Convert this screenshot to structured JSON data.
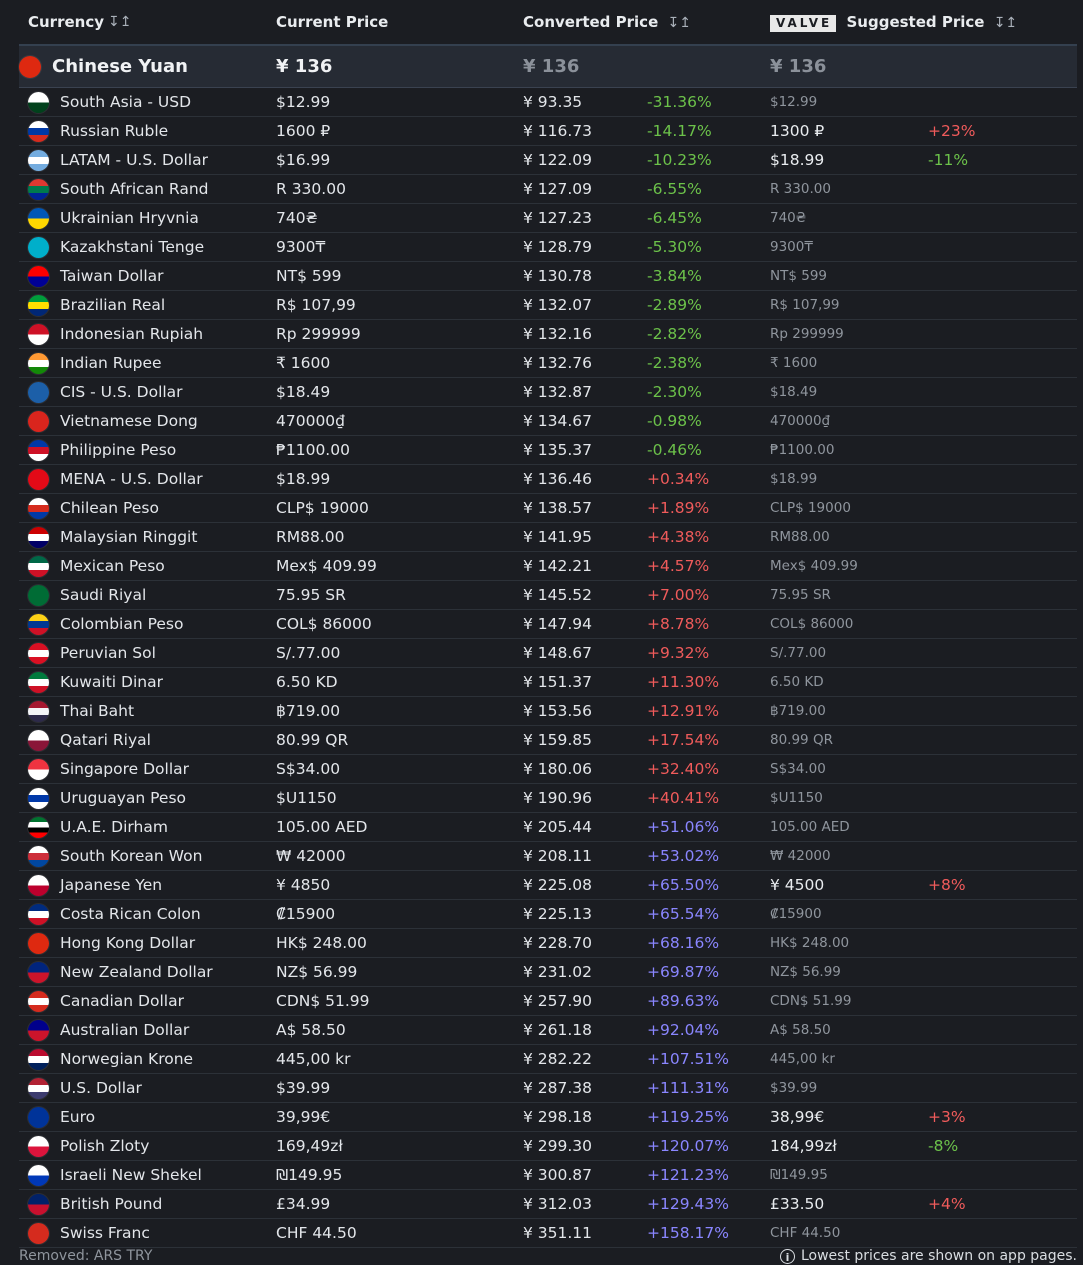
{
  "header": {
    "currency": "Currency",
    "current_price": "Current Price",
    "converted_price": "Converted Price",
    "valve_logo": "VALVE",
    "suggested_price": "Suggested Price",
    "sort_icon": "↧↥"
  },
  "base": {
    "name": "Chinese Yuan",
    "price": "¥ 136",
    "converted": "¥ 136",
    "suggested": "¥ 136",
    "flag_icon": "china-flag-icon",
    "flag_colors": [
      "#de2910",
      "#de2910"
    ]
  },
  "rows": [
    {
      "name": "South Asia - USD",
      "price": "$12.99",
      "converted": "¥ 93.35",
      "diff": "-31.36%",
      "diff_class": "green",
      "suggested": "$12.99",
      "sugg_hl": false,
      "sugg_diff": "",
      "sugg_diff_class": "",
      "flag_icon": "south-asia-flag-icon",
      "flag_colors": [
        "#ffffff",
        "#01411c"
      ]
    },
    {
      "name": "Russian Ruble",
      "price": "1600 ₽",
      "converted": "¥ 116.73",
      "diff": "-14.17%",
      "diff_class": "green",
      "suggested": "1300 ₽",
      "sugg_hl": true,
      "sugg_diff": "+23%",
      "sugg_diff_class": "red",
      "flag_icon": "russia-flag-icon",
      "flag_colors": [
        "#ffffff",
        "#0039a6",
        "#d52b1e"
      ]
    },
    {
      "name": "LATAM - U.S. Dollar",
      "price": "$16.99",
      "converted": "¥ 122.09",
      "diff": "-10.23%",
      "diff_class": "green",
      "suggested": "$18.99",
      "sugg_hl": true,
      "sugg_diff": "-11%",
      "sugg_diff_class": "green",
      "flag_icon": "latam-flag-icon",
      "flag_colors": [
        "#74acdf",
        "#ffffff",
        "#74acdf"
      ]
    },
    {
      "name": "South African Rand",
      "price": "R 330.00",
      "converted": "¥ 127.09",
      "diff": "-6.55%",
      "diff_class": "green",
      "suggested": "R 330.00",
      "sugg_hl": false,
      "sugg_diff": "",
      "sugg_diff_class": "",
      "flag_icon": "south-africa-flag-icon",
      "flag_colors": [
        "#de3831",
        "#007a4d",
        "#002395"
      ]
    },
    {
      "name": "Ukrainian Hryvnia",
      "price": "740₴",
      "converted": "¥ 127.23",
      "diff": "-6.45%",
      "diff_class": "green",
      "suggested": "740₴",
      "sugg_hl": false,
      "sugg_diff": "",
      "sugg_diff_class": "",
      "flag_icon": "ukraine-flag-icon",
      "flag_colors": [
        "#0057b7",
        "#ffd700"
      ]
    },
    {
      "name": "Kazakhstani Tenge",
      "price": "9300₸",
      "converted": "¥ 128.79",
      "diff": "-5.30%",
      "diff_class": "green",
      "suggested": "9300₸",
      "sugg_hl": false,
      "sugg_diff": "",
      "sugg_diff_class": "",
      "flag_icon": "kazakhstan-flag-icon",
      "flag_colors": [
        "#00afca",
        "#00afca"
      ]
    },
    {
      "name": "Taiwan Dollar",
      "price": "NT$ 599",
      "converted": "¥ 130.78",
      "diff": "-3.84%",
      "diff_class": "green",
      "suggested": "NT$ 599",
      "sugg_hl": false,
      "sugg_diff": "",
      "sugg_diff_class": "",
      "flag_icon": "taiwan-flag-icon",
      "flag_colors": [
        "#fe0000",
        "#000095"
      ]
    },
    {
      "name": "Brazilian Real",
      "price": "R$ 107,99",
      "converted": "¥ 132.07",
      "diff": "-2.89%",
      "diff_class": "green",
      "suggested": "R$ 107,99",
      "sugg_hl": false,
      "sugg_diff": "",
      "sugg_diff_class": "",
      "flag_icon": "brazil-flag-icon",
      "flag_colors": [
        "#009c3b",
        "#ffdf00",
        "#002776"
      ]
    },
    {
      "name": "Indonesian Rupiah",
      "price": "Rp 299999",
      "converted": "¥ 132.16",
      "diff": "-2.82%",
      "diff_class": "green",
      "suggested": "Rp 299999",
      "sugg_hl": false,
      "sugg_diff": "",
      "sugg_diff_class": "",
      "flag_icon": "indonesia-flag-icon",
      "flag_colors": [
        "#ce1126",
        "#ffffff"
      ]
    },
    {
      "name": "Indian Rupee",
      "price": "₹ 1600",
      "converted": "¥ 132.76",
      "diff": "-2.38%",
      "diff_class": "green",
      "suggested": "₹ 1600",
      "sugg_hl": false,
      "sugg_diff": "",
      "sugg_diff_class": "",
      "flag_icon": "india-flag-icon",
      "flag_colors": [
        "#ff9933",
        "#ffffff",
        "#138808"
      ]
    },
    {
      "name": "CIS - U.S. Dollar",
      "price": "$18.49",
      "converted": "¥ 132.87",
      "diff": "-2.30%",
      "diff_class": "green",
      "suggested": "$18.49",
      "sugg_hl": false,
      "sugg_diff": "",
      "sugg_diff_class": "",
      "flag_icon": "cis-flag-icon",
      "flag_colors": [
        "#1c5fa8",
        "#1c5fa8"
      ]
    },
    {
      "name": "Vietnamese Dong",
      "price": "470000₫",
      "converted": "¥ 134.67",
      "diff": "-0.98%",
      "diff_class": "green",
      "suggested": "470000₫",
      "sugg_hl": false,
      "sugg_diff": "",
      "sugg_diff_class": "",
      "flag_icon": "vietnam-flag-icon",
      "flag_colors": [
        "#da251d",
        "#da251d"
      ]
    },
    {
      "name": "Philippine Peso",
      "price": "₱1100.00",
      "converted": "¥ 135.37",
      "diff": "-0.46%",
      "diff_class": "green",
      "suggested": "₱1100.00",
      "sugg_hl": false,
      "sugg_diff": "",
      "sugg_diff_class": "",
      "flag_icon": "philippines-flag-icon",
      "flag_colors": [
        "#0038a8",
        "#ce1126",
        "#ffffff"
      ]
    },
    {
      "name": "MENA - U.S. Dollar",
      "price": "$18.99",
      "converted": "¥ 136.46",
      "diff": "+0.34%",
      "diff_class": "red",
      "suggested": "$18.99",
      "sugg_hl": false,
      "sugg_diff": "",
      "sugg_diff_class": "",
      "flag_icon": "mena-flag-icon",
      "flag_colors": [
        "#e30a17",
        "#e30a17"
      ]
    },
    {
      "name": "Chilean Peso",
      "price": "CLP$ 19000",
      "converted": "¥ 138.57",
      "diff": "+1.89%",
      "diff_class": "red",
      "suggested": "CLP$ 19000",
      "sugg_hl": false,
      "sugg_diff": "",
      "sugg_diff_class": "",
      "flag_icon": "chile-flag-icon",
      "flag_colors": [
        "#ffffff",
        "#d52b1e",
        "#0039a6"
      ]
    },
    {
      "name": "Malaysian Ringgit",
      "price": "RM88.00",
      "converted": "¥ 141.95",
      "diff": "+4.38%",
      "diff_class": "red",
      "suggested": "RM88.00",
      "sugg_hl": false,
      "sugg_diff": "",
      "sugg_diff_class": "",
      "flag_icon": "malaysia-flag-icon",
      "flag_colors": [
        "#cc0001",
        "#ffffff",
        "#010066"
      ]
    },
    {
      "name": "Mexican Peso",
      "price": "Mex$ 409.99",
      "converted": "¥ 142.21",
      "diff": "+4.57%",
      "diff_class": "red",
      "suggested": "Mex$ 409.99",
      "sugg_hl": false,
      "sugg_diff": "",
      "sugg_diff_class": "",
      "flag_icon": "mexico-flag-icon",
      "flag_colors": [
        "#006847",
        "#ffffff",
        "#ce1126"
      ]
    },
    {
      "name": "Saudi Riyal",
      "price": "75.95 SR",
      "converted": "¥ 145.52",
      "diff": "+7.00%",
      "diff_class": "red",
      "suggested": "75.95 SR",
      "sugg_hl": false,
      "sugg_diff": "",
      "sugg_diff_class": "",
      "flag_icon": "saudi-arabia-flag-icon",
      "flag_colors": [
        "#006c35",
        "#006c35"
      ]
    },
    {
      "name": "Colombian Peso",
      "price": "COL$ 86000",
      "converted": "¥ 147.94",
      "diff": "+8.78%",
      "diff_class": "red",
      "suggested": "COL$ 86000",
      "sugg_hl": false,
      "sugg_diff": "",
      "sugg_diff_class": "",
      "flag_icon": "colombia-flag-icon",
      "flag_colors": [
        "#fcd116",
        "#003893",
        "#ce1126"
      ]
    },
    {
      "name": "Peruvian Sol",
      "price": "S/.77.00",
      "converted": "¥ 148.67",
      "diff": "+9.32%",
      "diff_class": "red",
      "suggested": "S/.77.00",
      "sugg_hl": false,
      "sugg_diff": "",
      "sugg_diff_class": "",
      "flag_icon": "peru-flag-icon",
      "flag_colors": [
        "#d91023",
        "#ffffff",
        "#d91023"
      ]
    },
    {
      "name": "Kuwaiti Dinar",
      "price": "6.50 KD",
      "converted": "¥ 151.37",
      "diff": "+11.30%",
      "diff_class": "red",
      "suggested": "6.50 KD",
      "sugg_hl": false,
      "sugg_diff": "",
      "sugg_diff_class": "",
      "flag_icon": "kuwait-flag-icon",
      "flag_colors": [
        "#007a3d",
        "#ffffff",
        "#ce1126"
      ]
    },
    {
      "name": "Thai Baht",
      "price": "฿719.00",
      "converted": "¥ 153.56",
      "diff": "+12.91%",
      "diff_class": "red",
      "suggested": "฿719.00",
      "sugg_hl": false,
      "sugg_diff": "",
      "sugg_diff_class": "",
      "flag_icon": "thailand-flag-icon",
      "flag_colors": [
        "#a51931",
        "#f4f5f8",
        "#2d2a4a"
      ]
    },
    {
      "name": "Qatari Riyal",
      "price": "80.99 QR",
      "converted": "¥ 159.85",
      "diff": "+17.54%",
      "diff_class": "red",
      "suggested": "80.99 QR",
      "sugg_hl": false,
      "sugg_diff": "",
      "sugg_diff_class": "",
      "flag_icon": "qatar-flag-icon",
      "flag_colors": [
        "#ffffff",
        "#8a1538"
      ]
    },
    {
      "name": "Singapore Dollar",
      "price": "S$34.00",
      "converted": "¥ 180.06",
      "diff": "+32.40%",
      "diff_class": "red",
      "suggested": "S$34.00",
      "sugg_hl": false,
      "sugg_diff": "",
      "sugg_diff_class": "",
      "flag_icon": "singapore-flag-icon",
      "flag_colors": [
        "#ef3340",
        "#ffffff"
      ]
    },
    {
      "name": "Uruguayan Peso",
      "price": "$U1150",
      "converted": "¥ 190.96",
      "diff": "+40.41%",
      "diff_class": "red",
      "suggested": "$U1150",
      "sugg_hl": false,
      "sugg_diff": "",
      "sugg_diff_class": "",
      "flag_icon": "uruguay-flag-icon",
      "flag_colors": [
        "#ffffff",
        "#0038a8",
        "#ffffff"
      ]
    },
    {
      "name": "U.A.E. Dirham",
      "price": "105.00 AED",
      "converted": "¥ 205.44",
      "diff": "+51.06%",
      "diff_class": "blue",
      "suggested": "105.00 AED",
      "sugg_hl": false,
      "sugg_diff": "",
      "sugg_diff_class": "",
      "flag_icon": "uae-flag-icon",
      "flag_colors": [
        "#00732f",
        "#ffffff",
        "#000000",
        "#ff0000"
      ]
    },
    {
      "name": "South Korean Won",
      "price": "₩ 42000",
      "converted": "¥ 208.11",
      "diff": "+53.02%",
      "diff_class": "blue",
      "suggested": "₩ 42000",
      "sugg_hl": false,
      "sugg_diff": "",
      "sugg_diff_class": "",
      "flag_icon": "south-korea-flag-icon",
      "flag_colors": [
        "#ffffff",
        "#cd2e3a",
        "#0047a0"
      ]
    },
    {
      "name": "Japanese Yen",
      "price": "¥ 4850",
      "converted": "¥ 225.08",
      "diff": "+65.50%",
      "diff_class": "blue",
      "suggested": "¥ 4500",
      "sugg_hl": true,
      "sugg_diff": "+8%",
      "sugg_diff_class": "red",
      "flag_icon": "japan-flag-icon",
      "flag_colors": [
        "#ffffff",
        "#bc002d"
      ]
    },
    {
      "name": "Costa Rican Colon",
      "price": "₡15900",
      "converted": "¥ 225.13",
      "diff": "+65.54%",
      "diff_class": "blue",
      "suggested": "₡15900",
      "sugg_hl": false,
      "sugg_diff": "",
      "sugg_diff_class": "",
      "flag_icon": "costa-rica-flag-icon",
      "flag_colors": [
        "#002b7f",
        "#ffffff",
        "#ce1126"
      ]
    },
    {
      "name": "Hong Kong Dollar",
      "price": "HK$ 248.00",
      "converted": "¥ 228.70",
      "diff": "+68.16%",
      "diff_class": "blue",
      "suggested": "HK$ 248.00",
      "sugg_hl": false,
      "sugg_diff": "",
      "sugg_diff_class": "",
      "flag_icon": "hong-kong-flag-icon",
      "flag_colors": [
        "#de2910",
        "#de2910"
      ]
    },
    {
      "name": "New Zealand Dollar",
      "price": "NZ$ 56.99",
      "converted": "¥ 231.02",
      "diff": "+69.87%",
      "diff_class": "blue",
      "suggested": "NZ$ 56.99",
      "sugg_hl": false,
      "sugg_diff": "",
      "sugg_diff_class": "",
      "flag_icon": "new-zealand-flag-icon",
      "flag_colors": [
        "#00247d",
        "#cc142b"
      ]
    },
    {
      "name": "Canadian Dollar",
      "price": "CDN$ 51.99",
      "converted": "¥ 257.90",
      "diff": "+89.63%",
      "diff_class": "blue",
      "suggested": "CDN$ 51.99",
      "sugg_hl": false,
      "sugg_diff": "",
      "sugg_diff_class": "",
      "flag_icon": "canada-flag-icon",
      "flag_colors": [
        "#d52b1e",
        "#ffffff",
        "#d52b1e"
      ]
    },
    {
      "name": "Australian Dollar",
      "price": "A$ 58.50",
      "converted": "¥ 261.18",
      "diff": "+92.04%",
      "diff_class": "blue",
      "suggested": "A$ 58.50",
      "sugg_hl": false,
      "sugg_diff": "",
      "sugg_diff_class": "",
      "flag_icon": "australia-flag-icon",
      "flag_colors": [
        "#00008b",
        "#cc142b"
      ]
    },
    {
      "name": "Norwegian Krone",
      "price": "445,00 kr",
      "converted": "¥ 282.22",
      "diff": "+107.51%",
      "diff_class": "blue",
      "suggested": "445,00 kr",
      "sugg_hl": false,
      "sugg_diff": "",
      "sugg_diff_class": "",
      "flag_icon": "norway-flag-icon",
      "flag_colors": [
        "#ba0c2f",
        "#ffffff",
        "#00205b"
      ]
    },
    {
      "name": "U.S. Dollar",
      "price": "$39.99",
      "converted": "¥ 287.38",
      "diff": "+111.31%",
      "diff_class": "blue",
      "suggested": "$39.99",
      "sugg_hl": false,
      "sugg_diff": "",
      "sugg_diff_class": "",
      "flag_icon": "usa-flag-icon",
      "flag_colors": [
        "#b22234",
        "#ffffff",
        "#3c3b6e"
      ]
    },
    {
      "name": "Euro",
      "price": "39,99€",
      "converted": "¥ 298.18",
      "diff": "+119.25%",
      "diff_class": "blue",
      "suggested": "38,99€",
      "sugg_hl": true,
      "sugg_diff": "+3%",
      "sugg_diff_class": "red",
      "flag_icon": "eu-flag-icon",
      "flag_colors": [
        "#003399",
        "#003399"
      ]
    },
    {
      "name": "Polish Zloty",
      "price": "169,49zł",
      "converted": "¥ 299.30",
      "diff": "+120.07%",
      "diff_class": "blue",
      "suggested": "184,99zł",
      "sugg_hl": true,
      "sugg_diff": "-8%",
      "sugg_diff_class": "green",
      "flag_icon": "poland-flag-icon",
      "flag_colors": [
        "#ffffff",
        "#dc143c"
      ]
    },
    {
      "name": "Israeli New Shekel",
      "price": "₪149.95",
      "converted": "¥ 300.87",
      "diff": "+121.23%",
      "diff_class": "blue",
      "suggested": "₪149.95",
      "sugg_hl": false,
      "sugg_diff": "",
      "sugg_diff_class": "",
      "flag_icon": "israel-flag-icon",
      "flag_colors": [
        "#ffffff",
        "#0038b8"
      ]
    },
    {
      "name": "British Pound",
      "price": "£34.99",
      "converted": "¥ 312.03",
      "diff": "+129.43%",
      "diff_class": "blue",
      "suggested": "£33.50",
      "sugg_hl": true,
      "sugg_diff": "+4%",
      "sugg_diff_class": "red",
      "flag_icon": "uk-flag-icon",
      "flag_colors": [
        "#012169",
        "#c8102e"
      ]
    },
    {
      "name": "Swiss Franc",
      "price": "CHF 44.50",
      "converted": "¥ 351.11",
      "diff": "+158.17%",
      "diff_class": "blue",
      "suggested": "CHF 44.50",
      "sugg_hl": false,
      "sugg_diff": "",
      "sugg_diff_class": "",
      "flag_icon": "switzerland-flag-icon",
      "flag_colors": [
        "#d52b1e",
        "#d52b1e"
      ]
    }
  ],
  "footer": {
    "removed": "Removed: ARS TRY",
    "note": "Lowest prices are shown on app pages.",
    "info_icon": "i"
  }
}
